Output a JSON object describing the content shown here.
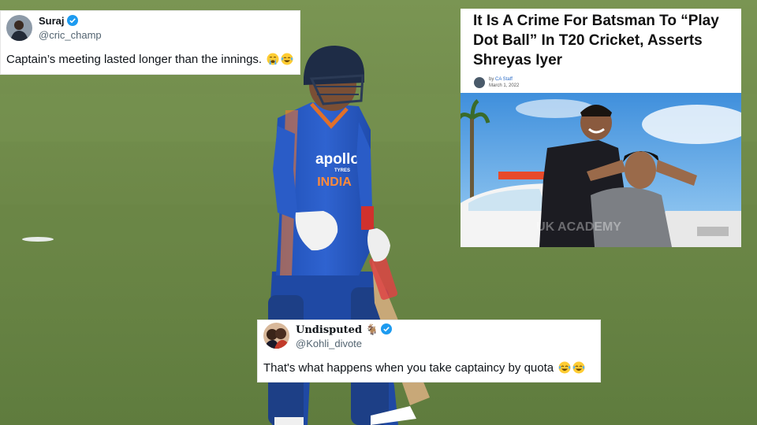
{
  "tweet_top": {
    "name": "Suraj",
    "handle": "@cric_champ",
    "text": "Captain’s meeting lasted longer than the innings.",
    "emojis": [
      "crying-face-emoji",
      "tears-of-joy-emoji"
    ]
  },
  "tweet_bottom": {
    "name": "Undisputed 🐐",
    "handle": "@Kohli_divote",
    "text": "That's what happens when you take captaincy by quota",
    "emojis": [
      "tears-of-joy-emoji",
      "tears-of-joy-emoji"
    ]
  },
  "article": {
    "headline": "It Is A Crime For Batsman To “Play Dot Ball” In T20 Cricket, Asserts Shreyas Iyer",
    "author": "CA Staff",
    "date": "March 1, 2022",
    "prefix": "by"
  },
  "jersey": {
    "sponsor": "apollo",
    "sponsor_sub": "TYRES",
    "team": "INDIA"
  },
  "colors": {
    "grass": "#6f8a49",
    "jersey_blue": "#2a5cc7",
    "twitter_blue": "#1d9bf0"
  }
}
